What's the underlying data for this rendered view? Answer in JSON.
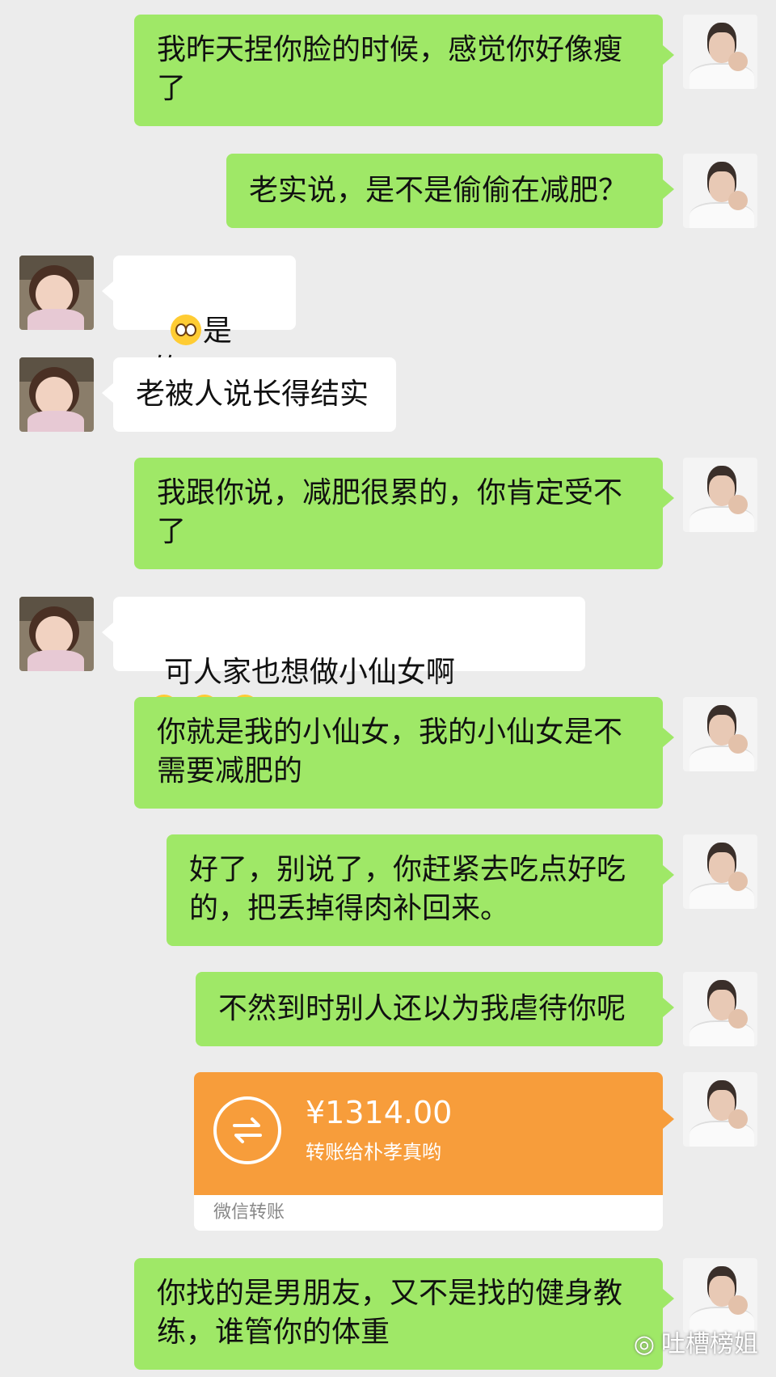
{
  "messages": [
    {
      "text": "我昨天捏你脸的时候，感觉你好像瘦\n了"
    },
    {
      "text": "老实说，是不是偷偷在减肥？"
    },
    {
      "text": "是的。",
      "emoji": "flushed-face"
    },
    {
      "text": "老被人说长得结实"
    },
    {
      "text": "我跟你说，减肥很累的，你肯定受不\n了"
    },
    {
      "text": "可人家也想做小仙女啊",
      "emoji": "laughing-crying-face"
    },
    {
      "text": "你就是我的小仙女，我的小仙女是不\n需要减肥的"
    },
    {
      "text": "好了，别说了，你赶紧去吃点好吃\n的，把丢掉得肉补回来。"
    },
    {
      "text": "不然到时别人还以为我虐待你呢"
    },
    {
      "text": "你找的是男朋友，又不是找的健身教\n练，谁管你的体重"
    }
  ],
  "transfer": {
    "amount": "¥1314.00",
    "description": "转账给朴孝真哟",
    "label": "微信转账",
    "icon": "transfer-arrows-icon"
  },
  "watermark": "吐槽榜姐",
  "colors": {
    "background": "#ececec",
    "sent_bubble": "#9fe867",
    "received_bubble": "#ffffff",
    "transfer_card": "#f79d3b"
  }
}
